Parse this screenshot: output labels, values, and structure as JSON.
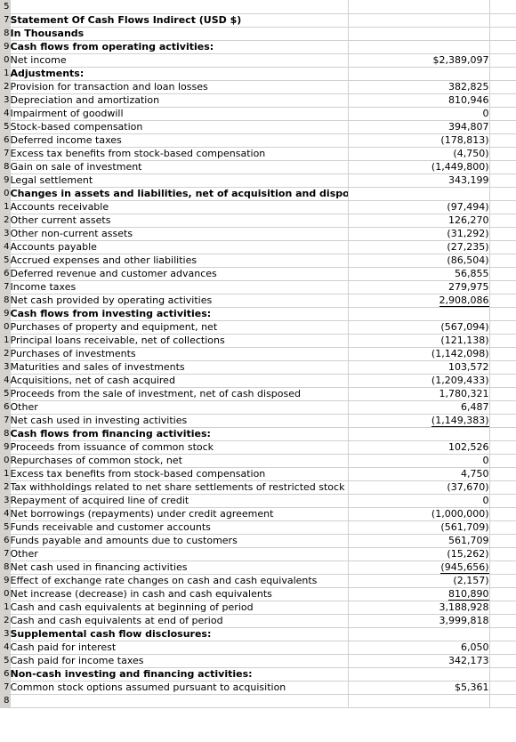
{
  "document": {
    "title": "Statement Of Cash Flows Indirect (USD $)",
    "subtitle": "In Thousands",
    "type": "spreadsheet"
  },
  "columns": {
    "row_header": "",
    "label": "",
    "value": "",
    "extra": ""
  },
  "rows": [
    {
      "num": "5",
      "label": "",
      "value": "",
      "bold": false,
      "align": "left",
      "underline": false,
      "tall": false
    },
    {
      "num": "7",
      "label": "Statement Of Cash Flows Indirect (USD $)",
      "value": "",
      "bold": true,
      "align": "center",
      "underline": false,
      "tall": false
    },
    {
      "num": "8",
      "label": "In Thousands",
      "value": "",
      "bold": true,
      "align": "center",
      "underline": false,
      "tall": false
    },
    {
      "num": "9",
      "label": "Cash flows from operating activities:",
      "value": "",
      "bold": true,
      "align": "left",
      "underline": false,
      "tall": false
    },
    {
      "num": "0",
      "label": "Net income",
      "value": "$2,389,097",
      "bold": false,
      "align": "left",
      "underline": false,
      "tall": false
    },
    {
      "num": "1",
      "label": "Adjustments:",
      "value": "",
      "bold": true,
      "align": "left",
      "underline": false,
      "tall": false
    },
    {
      "num": "2",
      "label": "Provision for transaction and loan losses",
      "value": "382,825",
      "bold": false,
      "align": "left",
      "underline": false,
      "tall": false
    },
    {
      "num": "3",
      "label": "Depreciation and amortization",
      "value": "810,946",
      "bold": false,
      "align": "left",
      "underline": false,
      "tall": false
    },
    {
      "num": "4",
      "label": "Impairment of goodwill",
      "value": "0",
      "bold": false,
      "align": "left",
      "underline": false,
      "tall": false
    },
    {
      "num": "5",
      "label": "Stock-based compensation",
      "value": "394,807",
      "bold": false,
      "align": "left",
      "underline": false,
      "tall": false
    },
    {
      "num": "6",
      "label": "Deferred income taxes",
      "value": "(178,813)",
      "bold": false,
      "align": "left",
      "underline": false,
      "tall": false
    },
    {
      "num": "7",
      "label": "Excess tax benefits from stock-based compensation",
      "value": "(4,750)",
      "bold": false,
      "align": "left",
      "underline": false,
      "tall": false
    },
    {
      "num": "8",
      "label": "Gain on sale of investment",
      "value": "(1,449,800)",
      "bold": false,
      "align": "left",
      "underline": false,
      "tall": false
    },
    {
      "num": "9",
      "label": "Legal settlement",
      "value": "343,199",
      "bold": false,
      "align": "left",
      "underline": false,
      "tall": false
    },
    {
      "num": "0",
      "label": "Changes in assets and liabilities, net of acquisition and disposition effects:",
      "value": "",
      "bold": true,
      "align": "left",
      "underline": false,
      "tall": true
    },
    {
      "num": "1",
      "label": "Accounts receivable",
      "value": "(97,494)",
      "bold": false,
      "align": "left",
      "underline": false,
      "tall": false
    },
    {
      "num": "2",
      "label": "Other current assets",
      "value": "126,270",
      "bold": false,
      "align": "left",
      "underline": false,
      "tall": false
    },
    {
      "num": "3",
      "label": "Other non-current assets",
      "value": "(31,292)",
      "bold": false,
      "align": "left",
      "underline": false,
      "tall": false
    },
    {
      "num": "4",
      "label": "Accounts payable",
      "value": "(27,235)",
      "bold": false,
      "align": "left",
      "underline": false,
      "tall": false
    },
    {
      "num": "5",
      "label": "Accrued expenses and other liabilities",
      "value": "(86,504)",
      "bold": false,
      "align": "left",
      "underline": false,
      "tall": false
    },
    {
      "num": "6",
      "label": "Deferred revenue and customer advances",
      "value": "56,855",
      "bold": false,
      "align": "left",
      "underline": false,
      "tall": false
    },
    {
      "num": "7",
      "label": "Income taxes",
      "value": "279,975",
      "bold": false,
      "align": "left",
      "underline": false,
      "tall": false
    },
    {
      "num": "8",
      "label": "Net cash provided by operating activities",
      "value": "2,908,086",
      "bold": false,
      "align": "left",
      "underline": true,
      "tall": false
    },
    {
      "num": "9",
      "label": "Cash flows from investing activities:",
      "value": "",
      "bold": true,
      "align": "left",
      "underline": false,
      "tall": false
    },
    {
      "num": "0",
      "label": "Purchases of property and equipment, net",
      "value": "(567,094)",
      "bold": false,
      "align": "left",
      "underline": false,
      "tall": false
    },
    {
      "num": "1",
      "label": "Principal loans receivable, net of collections",
      "value": "(121,138)",
      "bold": false,
      "align": "left",
      "underline": false,
      "tall": false
    },
    {
      "num": "2",
      "label": "Purchases of investments",
      "value": "(1,142,098)",
      "bold": false,
      "align": "left",
      "underline": false,
      "tall": false
    },
    {
      "num": "3",
      "label": "Maturities and sales of investments",
      "value": "103,572",
      "bold": false,
      "align": "left",
      "underline": false,
      "tall": false
    },
    {
      "num": "4",
      "label": "Acquisitions, net of cash acquired",
      "value": "(1,209,433)",
      "bold": false,
      "align": "left",
      "underline": false,
      "tall": false
    },
    {
      "num": "5",
      "label": "Proceeds from the sale of investment, net of cash disposed",
      "value": "1,780,321",
      "bold": false,
      "align": "left",
      "underline": false,
      "tall": false
    },
    {
      "num": "6",
      "label": "Other",
      "value": "6,487",
      "bold": false,
      "align": "left",
      "underline": false,
      "tall": false
    },
    {
      "num": "7",
      "label": "Net cash used in investing activities",
      "value": "(1,149,383)",
      "bold": false,
      "align": "left",
      "underline": true,
      "tall": false
    },
    {
      "num": "8",
      "label": "Cash flows from financing activities:",
      "value": "",
      "bold": true,
      "align": "left",
      "underline": false,
      "tall": false
    },
    {
      "num": "9",
      "label": "Proceeds from issuance of common stock",
      "value": "102,526",
      "bold": false,
      "align": "left",
      "underline": false,
      "tall": false
    },
    {
      "num": "0",
      "label": "Repurchases of common stock, net",
      "value": "0",
      "bold": false,
      "align": "left",
      "underline": false,
      "tall": false
    },
    {
      "num": "1",
      "label": "Excess tax benefits from stock-based compensation",
      "value": "4,750",
      "bold": false,
      "align": "left",
      "underline": false,
      "tall": false
    },
    {
      "num": "2",
      "label": "Tax withholdings related to net share settlements of restricted stock awards and units",
      "value": "(37,670)",
      "bold": false,
      "align": "left",
      "underline": false,
      "tall": true
    },
    {
      "num": "3",
      "label": "Repayment of acquired line of credit",
      "value": "0",
      "bold": false,
      "align": "left",
      "underline": false,
      "tall": false
    },
    {
      "num": "4",
      "label": "Net borrowings (repayments) under credit agreement",
      "value": "(1,000,000)",
      "bold": false,
      "align": "left",
      "underline": false,
      "tall": false
    },
    {
      "num": "5",
      "label": "Funds receivable and customer accounts",
      "value": "(561,709)",
      "bold": false,
      "align": "left",
      "underline": false,
      "tall": false
    },
    {
      "num": "6",
      "label": "Funds payable and amounts due to customers",
      "value": "561,709",
      "bold": false,
      "align": "left",
      "underline": false,
      "tall": false
    },
    {
      "num": "7",
      "label": "Other",
      "value": "(15,262)",
      "bold": false,
      "align": "left",
      "underline": false,
      "tall": false
    },
    {
      "num": "8",
      "label": "Net cash used in financing activities",
      "value": "(945,656)",
      "bold": false,
      "align": "left",
      "underline": true,
      "tall": false
    },
    {
      "num": "9",
      "label": "Effect of exchange rate changes on cash and cash equivalents",
      "value": "(2,157)",
      "bold": false,
      "align": "left",
      "underline": false,
      "tall": false
    },
    {
      "num": "0",
      "label": "Net increase (decrease) in cash and cash equivalents",
      "value": "810,890",
      "bold": false,
      "align": "left",
      "underline": true,
      "tall": false
    },
    {
      "num": "1",
      "label": "Cash and cash equivalents at beginning of period",
      "value": "3,188,928",
      "bold": false,
      "align": "left",
      "underline": false,
      "tall": false
    },
    {
      "num": "2",
      "label": "Cash and cash equivalents at end of period",
      "value": "3,999,818",
      "bold": false,
      "align": "left",
      "underline": false,
      "tall": false
    },
    {
      "num": "3",
      "label": "Supplemental cash flow disclosures:",
      "value": "",
      "bold": true,
      "align": "left",
      "underline": false,
      "tall": false
    },
    {
      "num": "4",
      "label": "Cash paid for interest",
      "value": "6,050",
      "bold": false,
      "align": "left",
      "underline": false,
      "tall": false
    },
    {
      "num": "5",
      "label": "Cash paid for income taxes",
      "value": "342,173",
      "bold": false,
      "align": "left",
      "underline": false,
      "tall": false
    },
    {
      "num": "6",
      "label": "Non-cash investing and financing activities:",
      "value": "",
      "bold": true,
      "align": "left",
      "underline": false,
      "tall": false
    },
    {
      "num": "7",
      "label": "Common stock options assumed pursuant to acquisition",
      "value": "$5,361",
      "bold": false,
      "align": "left",
      "underline": false,
      "tall": false
    },
    {
      "num": "8",
      "label": "",
      "value": "",
      "bold": false,
      "align": "left",
      "underline": false,
      "tall": false
    }
  ]
}
